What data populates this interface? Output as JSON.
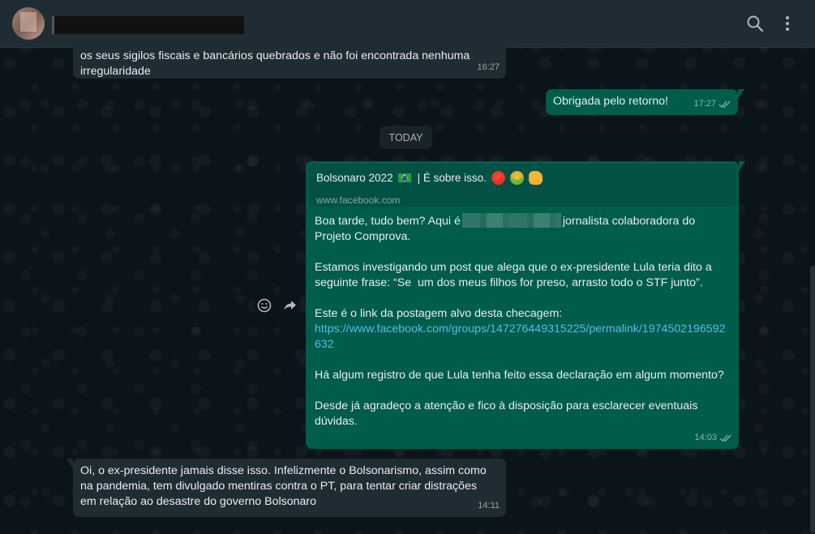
{
  "header": {
    "icons": {
      "search": "search-icon",
      "menu": "kebab-menu-icon"
    }
  },
  "messages": {
    "m1": {
      "text": "os seus sigilos fiscais e bancários quebrados e não foi encontrada nenhuma\nirregularidade",
      "time": "16:27"
    },
    "m2": {
      "text": "Obrigada pelo retorno!",
      "time": "17:27"
    },
    "date_badge": "TODAY",
    "m3": {
      "preview_title": "Bolsonaro 2022",
      "preview_title_suffix": "| É sobre isso.",
      "preview_url": "www.facebook.com",
      "line1_a": "Boa tarde, tudo bem? Aqui é",
      "line1_b": "jornalista colaboradora do",
      "line2": "Projeto Comprova.",
      "para2": "Estamos investigando um post que alega que o ex-presidente Lula teria dito a seguinte frase: “Se  um dos meus filhos for preso, arrasto todo o STF junto”.",
      "para3": "Este é o link da postagem alvo desta checagem:",
      "link": "https://www.facebook.com/groups/147276449315225/permalink/1974502196592632",
      "para4": "Há algum registro de que Lula tenha feito essa declaração em algum momento?",
      "para5": "Desde já agradeço a atenção e fico à disposição para esclarecer eventuais dúvidas.",
      "time": "14:03"
    },
    "m4": {
      "text": "Oi, o ex-presidente jamais disse isso. Infelizmente o Bolsonarismo, assim como\nna pandemia, tem divulgado mentiras contra o PT, para tentar criar distrações\nem relação ao desastre do governo Bolsonaro",
      "time": "14:11"
    }
  },
  "side_actions": {
    "emoji": "emoji-icon",
    "forward": "forward-icon"
  },
  "colors": {
    "outgoing": "#005c4b",
    "incoming": "#202c33",
    "link": "#53bdeb",
    "header": "#202c33",
    "background": "#0b141a"
  }
}
